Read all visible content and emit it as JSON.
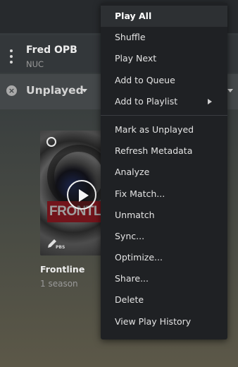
{
  "server": {
    "name": "Fred OPB",
    "sub": "NUC"
  },
  "filter": {
    "label": "Unplayed",
    "clear_icon": "close-icon"
  },
  "item": {
    "title": "Frontline",
    "subtitle": "1 season",
    "poster_text": "FRONTLINE",
    "network": "PBS"
  },
  "menu": {
    "group1": [
      "Play All",
      "Shuffle",
      "Play Next",
      "Add to Queue",
      "Add to Playlist"
    ],
    "group2": [
      "Mark as Unplayed",
      "Refresh Metadata",
      "Analyze",
      "Fix Match...",
      "Unmatch",
      "Sync...",
      "Optimize...",
      "Share...",
      "Delete",
      "View Play History"
    ]
  },
  "colors": {
    "menu_bg": "#1f2124",
    "menu_active": "#2d3033",
    "brand_red": "#b0202a"
  }
}
